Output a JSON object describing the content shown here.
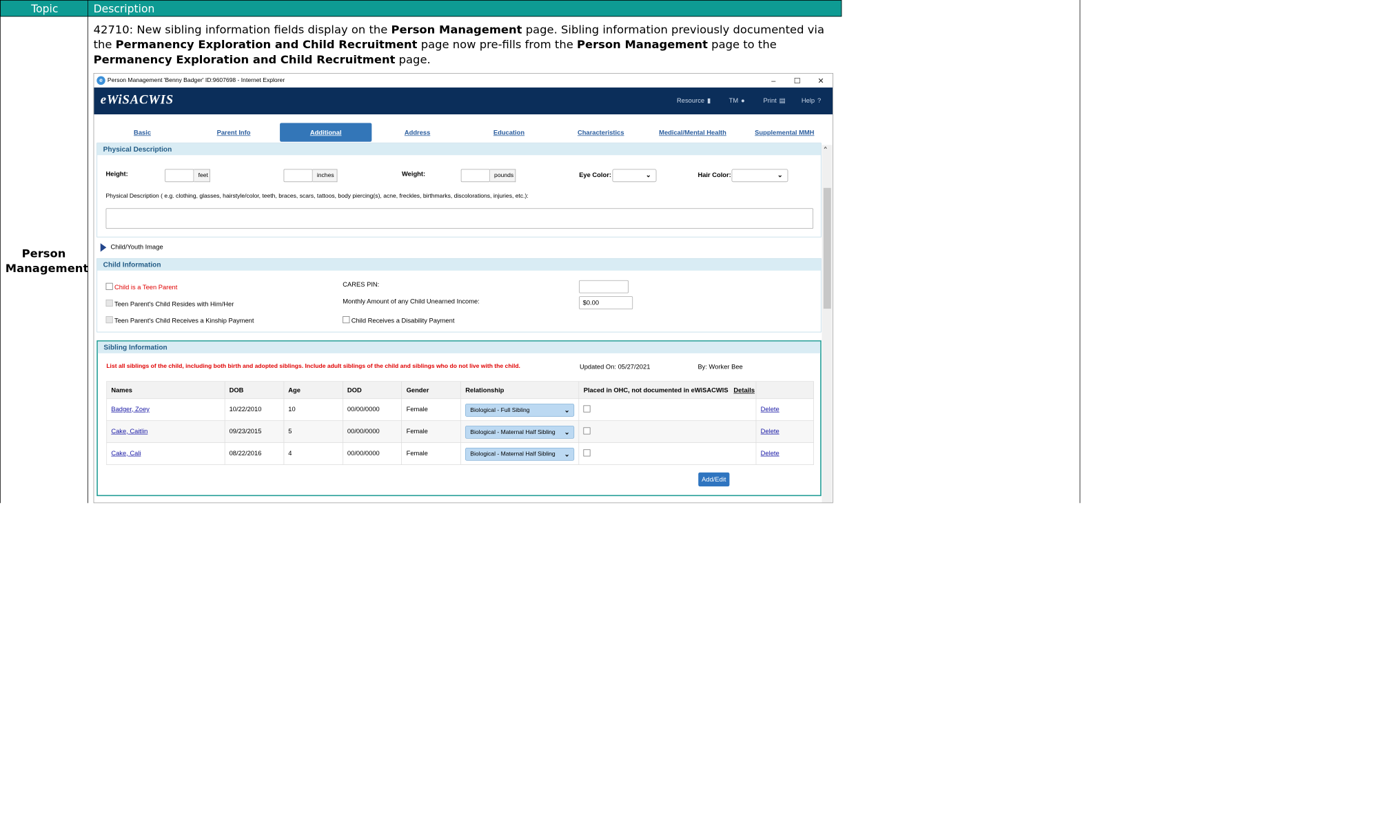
{
  "table": {
    "topic_header": "Topic",
    "description_header": "Description",
    "topic": "Person Management",
    "desc": {
      "p1": "42710: New sibling information fields display on the ",
      "b1": "Person Management",
      "p2": " page. Sibling information previously documented via the ",
      "b2": "Permanency Exploration and Child Recruitment",
      "p3": " page now pre-fills from the ",
      "b3": "Person Management",
      "p4": " page to the ",
      "b4": "Permanency Exploration and Child Recruitment",
      "p5": " page."
    }
  },
  "window": {
    "title": "Person Management 'Benny Badger' ID:9607698 - Internet Explorer",
    "minimize": "–",
    "maximize": "☐",
    "close": "✕"
  },
  "app": {
    "logo": "eWiSACWIS",
    "nav": [
      {
        "label": "Resource",
        "icon": "▮"
      },
      {
        "label": "TM",
        "icon": "●"
      },
      {
        "label": "Print",
        "icon": "▤"
      },
      {
        "label": "Help",
        "icon": "?"
      }
    ]
  },
  "tabs": [
    "Basic",
    "Parent Info",
    "Additional",
    "Address",
    "Education",
    "Characteristics",
    "Medical/Mental Health",
    "Supplemental MMH"
  ],
  "active_tab": "Additional",
  "physical": {
    "title": "Physical Description",
    "height_label": "Height:",
    "feet": "feet",
    "inches": "inches",
    "weight_label": "Weight:",
    "pounds": "pounds",
    "eye_label": "Eye Color:",
    "hair_label": "Hair Color:",
    "desc_label": "Physical Description ( e.g. clothing, glasses, hairstyle/color, teeth, braces, scars, tattoos, body piercing(s), acne, freckles, birthmarks, discolorations, injuries, etc.):"
  },
  "child_image": "Child/Youth Image",
  "child_info": {
    "title": "Child Information",
    "teen_parent": "Child is a Teen Parent",
    "resides": "Teen Parent's Child Resides with Him/Her",
    "kinship": "Teen Parent's Child Receives a Kinship Payment",
    "cares_pin": "CARES PIN:",
    "monthly": "Monthly Amount of any Child Unearned Income:",
    "monthly_value": "$0.00",
    "disability": "Child Receives a Disability Payment"
  },
  "sibling": {
    "title": "Sibling Information",
    "instruction": "List all siblings of the child, including both birth and adopted siblings. Include adult siblings of the child and siblings who do not live with the child.",
    "updated_on": "Updated On:  05/27/2021",
    "by": "By:  Worker Bee",
    "columns": [
      "Names",
      "DOB",
      "Age",
      "DOD",
      "Gender",
      "Relationship",
      "Placed in OHC, not documented in eWiSACWIS"
    ],
    "details": "Details",
    "rows": [
      {
        "name": "Badger, Zoey",
        "dob": "10/22/2010",
        "age": "10",
        "dod": "00/00/0000",
        "gender": "Female",
        "relationship": "Biological - Full Sibling",
        "action": "Delete"
      },
      {
        "name": "Cake, Caitlin",
        "dob": "09/23/2015",
        "age": "5",
        "dod": "00/00/0000",
        "gender": "Female",
        "relationship": "Biological - Maternal Half Sibling",
        "action": "Delete"
      },
      {
        "name": "Cake, Cali",
        "dob": "08/22/2016",
        "age": "4",
        "dod": "00/00/0000",
        "gender": "Female",
        "relationship": "Biological - Maternal Half Sibling",
        "action": "Delete"
      }
    ],
    "add_edit": "Add/Edit"
  }
}
